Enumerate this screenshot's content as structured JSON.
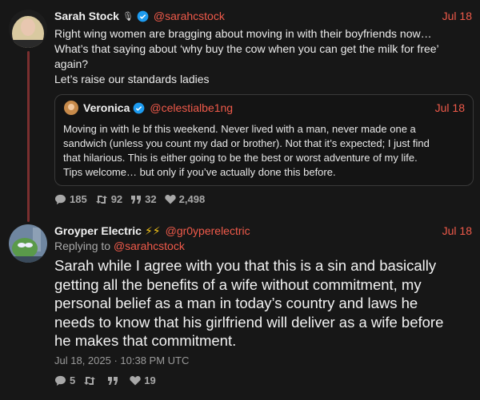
{
  "tweet1": {
    "name": "Sarah Stock",
    "badge_glyph": "🎙",
    "handle": "@sarahcstock",
    "date": "Jul 18",
    "text_lines": [
      "Right wing women are bragging about moving in with their boyfriends now…",
      "What’s that saying about ‘why buy the cow when you can get the milk for free’",
      "again?",
      "Let’s raise our standards ladies"
    ],
    "quote": {
      "name": "Veronica",
      "handle": "@celestialbe1ng",
      "date": "Jul 18",
      "text_lines": [
        "Moving in with le bf this weekend. Never lived with a man, never made one a",
        "sandwich (unless you count my dad or brother). Not that it’s expected; I just find",
        "that hilarious. This is either going to be the best or worst adventure of my life.",
        "Tips welcome… but only if you’ve actually done this before."
      ]
    },
    "stats": {
      "replies": "185",
      "retweets": "92",
      "quotes": "32",
      "likes": "2,498"
    }
  },
  "tweet2": {
    "name": "Groyper Electric",
    "name_emoji": "⚡⚡",
    "handle": "@gr0yperelectric",
    "date": "Jul 18",
    "replying_prefix": "Replying to",
    "replying_to": "@sarahcstock",
    "text_lines": [
      "Sarah while I agree with you that this is a sin and basically",
      "getting all the benefits of a wife without commitment, my",
      "personal belief as a man in today’s country and laws he",
      "needs to know that his girlfriend will deliver as a wife before",
      "he makes that commitment."
    ],
    "timestamp": "Jul 18, 2025 · 10:38 PM UTC",
    "stats": {
      "replies": "5",
      "retweets": "",
      "quotes": "",
      "likes": "19"
    }
  },
  "colors": {
    "accent": "#f05a4a",
    "background": "#171717",
    "verified": "#1d9bf0"
  }
}
